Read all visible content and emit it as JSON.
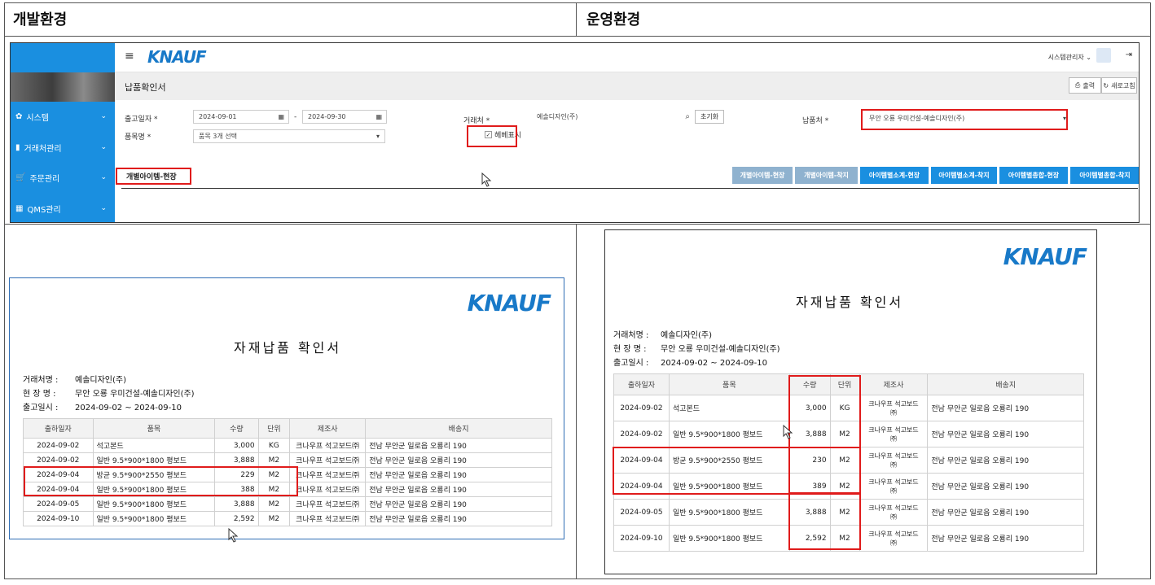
{
  "headers": {
    "dev": "개발환경",
    "prod": "운영환경"
  },
  "app": {
    "brand": "KNAUF",
    "menu_icon": "hamburger-icon",
    "user": "시스템관리자",
    "page_title": "납품확인서",
    "print_label": "출력",
    "refresh_label": "새로고침",
    "sidebar": [
      {
        "icon": "gear-icon",
        "label": "시스템"
      },
      {
        "icon": "bookmark-icon",
        "label": "거래처관리"
      },
      {
        "icon": "cart-icon",
        "label": "주문관리"
      },
      {
        "icon": "grid-icon",
        "label": "QMS관리"
      }
    ],
    "filters": {
      "ship_date_label": "출고일자",
      "date_from": "2024-09-01",
      "date_sep": "-",
      "date_to": "2024-09-30",
      "item_label": "품목명",
      "item_value": "품목 3개 선택",
      "client_label": "거래처",
      "client_value": "예솔디자인(주)",
      "reset_label": "초기화",
      "hebe_label": "헤베표시",
      "hebe_checked": true,
      "dest_label": "납품처",
      "dest_value": "무안 오룡 우미건설-예솔디자인(주)"
    },
    "active_tab": "개별아이템-현장",
    "tabs": [
      {
        "label": "개별아이템-현장",
        "color": "#8fb2cf"
      },
      {
        "label": "개별아이템-착지",
        "color": "#8fb2cf"
      },
      {
        "label": "아이템별소계-현장",
        "color": "#1a8fe0"
      },
      {
        "label": "아이템별소계-착지",
        "color": "#1a8fe0"
      },
      {
        "label": "아이템별총합-현장",
        "color": "#1a8fe0"
      },
      {
        "label": "아이템별총합-착지",
        "color": "#1a8fe0"
      }
    ]
  },
  "doc_dev": {
    "logo": "KNAUF",
    "title": "자재납품 확인서",
    "client_label": "거래처명 :",
    "client": "예솔디자인(주)",
    "site_label": "현 장 명 :",
    "site": "무안 오룡 우미건설-예솔디자인(주)",
    "period_label": "출고일시 :",
    "period": "2024-09-02 ~ 2024-09-10",
    "columns": [
      "출하일자",
      "품목",
      "수량",
      "단위",
      "제조사",
      "배송지"
    ],
    "rows": [
      [
        "2024-09-02",
        "석고본드",
        "3,000",
        "KG",
        "크나우프 석고보드㈜",
        "전남 무안군 일로읍 오룡리 190"
      ],
      [
        "2024-09-02",
        "일반 9.5*900*1800 평보드",
        "3,888",
        "M2",
        "크나우프 석고보드㈜",
        "전남 무안군 일로읍 오룡리 190"
      ],
      [
        "2024-09-04",
        "방균 9.5*900*2550 평보드",
        "229",
        "M2",
        "크나우프 석고보드㈜",
        "전남 무안군 일로읍 오룡리 190"
      ],
      [
        "2024-09-04",
        "일반 9.5*900*1800 평보드",
        "388",
        "M2",
        "크나우프 석고보드㈜",
        "전남 무안군 일로읍 오룡리 190"
      ],
      [
        "2024-09-05",
        "일반 9.5*900*1800 평보드",
        "3,888",
        "M2",
        "크나우프 석고보드㈜",
        "전남 무안군 일로읍 오룡리 190"
      ],
      [
        "2024-09-10",
        "일반 9.5*900*1800 평보드",
        "2,592",
        "M2",
        "크나우프 석고보드㈜",
        "전남 무안군 일로읍 오룡리 190"
      ]
    ]
  },
  "doc_prod": {
    "logo": "KNAUF",
    "title": "자재납품 확인서",
    "client_label": "거래처명 :",
    "client": "예솔디자인(주)",
    "site_label": "현 장 명 :",
    "site": "무안 오룡 우미건설-예솔디자인(주)",
    "period_label": "출고일시 :",
    "period": "2024-09-02 ~ 2024-09-10",
    "columns": [
      "출하일자",
      "품목",
      "수량",
      "단위",
      "제조사",
      "배송지"
    ],
    "maker_line1": "크나우프 석고보드",
    "maker_line2": "㈜",
    "rows": [
      [
        "2024-09-02",
        "석고본드",
        "3,000",
        "KG",
        "전남 무안군 일로읍 오룡리 190"
      ],
      [
        "2024-09-02",
        "일반 9.5*900*1800 평보드",
        "3,888",
        "M2",
        "전남 무안군 일로읍 오룡리 190"
      ],
      [
        "2024-09-04",
        "방균 9.5*900*2550 평보드",
        "230",
        "M2",
        "전남 무안군 일로읍 오룡리 190"
      ],
      [
        "2024-09-04",
        "일반 9.5*900*1800 평보드",
        "389",
        "M2",
        "전남 무안군 일로읍 오룡리 190"
      ],
      [
        "2024-09-05",
        "일반 9.5*900*1800 평보드",
        "3,888",
        "M2",
        "전남 무안군 일로읍 오룡리 190"
      ],
      [
        "2024-09-10",
        "일반 9.5*900*1800 평보드",
        "2,592",
        "M2",
        "전남 무안군 일로읍 오룡리 190"
      ]
    ]
  }
}
